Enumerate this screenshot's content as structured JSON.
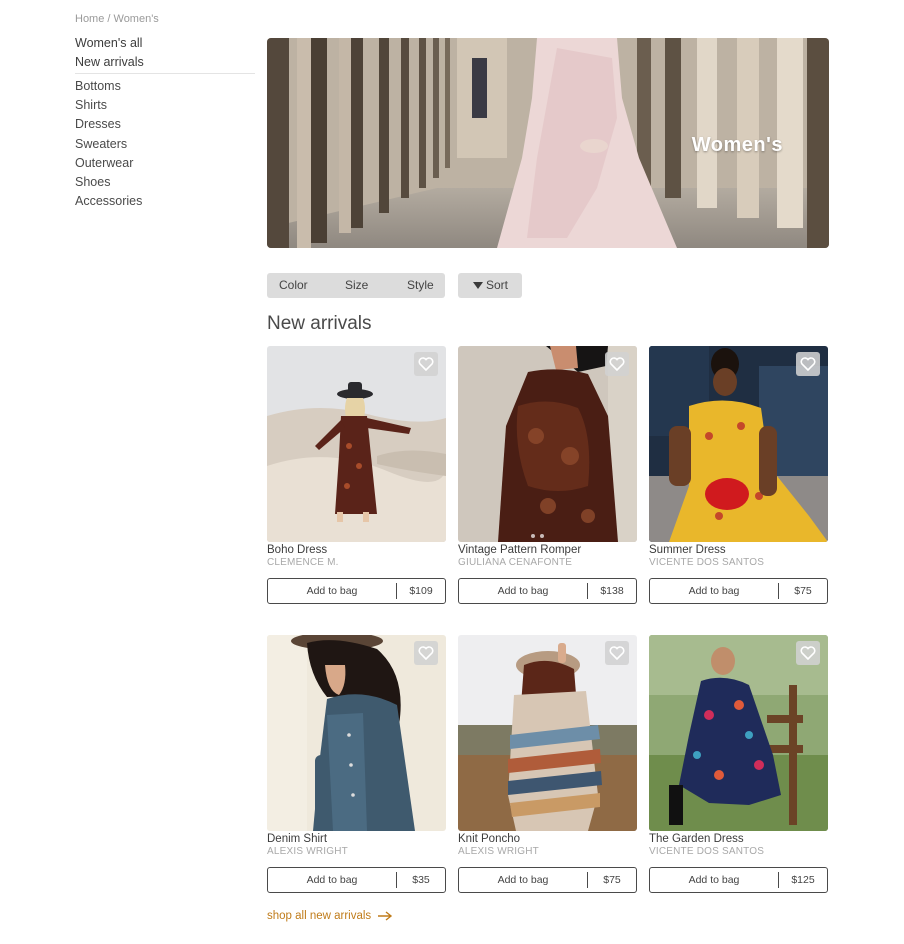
{
  "breadcrumb": "Home / Women's",
  "sidebar": {
    "top": [
      "Women's all",
      "New arrivals"
    ],
    "categories": [
      "Bottoms",
      "Shirts",
      "Dresses",
      "Sweaters",
      "Outerwear",
      "Shoes",
      "Accessories"
    ]
  },
  "hero": {
    "title": "Women's"
  },
  "filters": {
    "color": "Color",
    "size": "Size",
    "style": "Style",
    "sort": "Sort"
  },
  "section_title": "New arrivals",
  "products": [
    {
      "name": "Boho Dress",
      "author": "CLEMENCE M.",
      "add_label": "Add to bag",
      "price": "$109"
    },
    {
      "name": "Vintage Pattern Romper",
      "author": "GIULIANA CENAFONTE",
      "add_label": "Add to bag",
      "price": "$138"
    },
    {
      "name": "Summer Dress",
      "author": "VICENTE DOS SANTOS",
      "add_label": "Add to bag",
      "price": "$75"
    },
    {
      "name": "Denim Shirt",
      "author": "ALEXIS WRIGHT",
      "add_label": "Add to bag",
      "price": "$35"
    },
    {
      "name": "Knit Poncho",
      "author": "ALEXIS WRIGHT",
      "add_label": "Add to bag",
      "price": "$75"
    },
    {
      "name": "The Garden Dress",
      "author": "VICENTE DOS SANTOS",
      "add_label": "Add to bag",
      "price": "$125"
    }
  ],
  "shop_all_link": "shop all new arrivals",
  "colors": {
    "link_accent": "#c07c1a",
    "filter_bg": "#dcdcdc",
    "button_border": "#4a4a4a"
  }
}
